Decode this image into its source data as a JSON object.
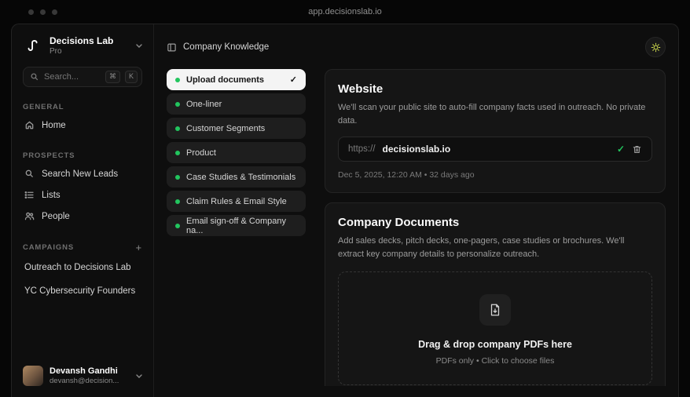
{
  "browser": {
    "url": "app.decisionslab.io"
  },
  "sidebar": {
    "workspace": {
      "name": "Decisions Lab",
      "plan": "Pro"
    },
    "search": {
      "placeholder": "Search...",
      "shortcut": [
        "⌘",
        "K"
      ]
    },
    "sections": [
      {
        "label": "GENERAL",
        "items": [
          {
            "label": "Home"
          }
        ]
      },
      {
        "label": "PROSPECTS",
        "items": [
          {
            "label": "Search New Leads"
          },
          {
            "label": "Lists"
          },
          {
            "label": "People"
          }
        ]
      },
      {
        "label": "CAMPAIGNS",
        "add_label": "+",
        "items": [
          {
            "label": "Outreach to Decisions Lab"
          },
          {
            "label": "YC Cybersecurity Founders"
          }
        ]
      }
    ],
    "user": {
      "name": "Devansh Gandhi",
      "email": "devansh@decision..."
    }
  },
  "main": {
    "header": {
      "title": "Company Knowledge"
    },
    "steps": [
      {
        "label": "Upload documents",
        "active": true,
        "check": "✓"
      },
      {
        "label": "One-liner"
      },
      {
        "label": "Customer Segments"
      },
      {
        "label": "Product"
      },
      {
        "label": "Case Studies & Testimonials"
      },
      {
        "label": "Claim Rules & Email Style"
      },
      {
        "label": "Email sign-off & Company na..."
      }
    ],
    "website_card": {
      "title": "Website",
      "description": "We'll scan your public site to auto-fill company facts used in outreach. No private data.",
      "url_prefix": "https://",
      "url_value": "decisionslab.io",
      "valid_check": "✓",
      "timestamp": "Dec 5, 2025, 12:20 AM • 32 days ago"
    },
    "documents_card": {
      "title": "Company Documents",
      "description": "Add sales decks, pitch decks, one-pagers, case studies or brochures. We'll extract key company details to personalize outreach.",
      "dropzone_title": "Drag & drop company PDFs here",
      "dropzone_subtitle": "PDFs only • Click to choose files"
    }
  },
  "colors": {
    "accent_green": "#22c55e",
    "active_step_bg": "#f4f4f4",
    "sun_icon": "#d3e04e",
    "card_bg": "#151515",
    "window_bg": "#0e0e0e"
  }
}
